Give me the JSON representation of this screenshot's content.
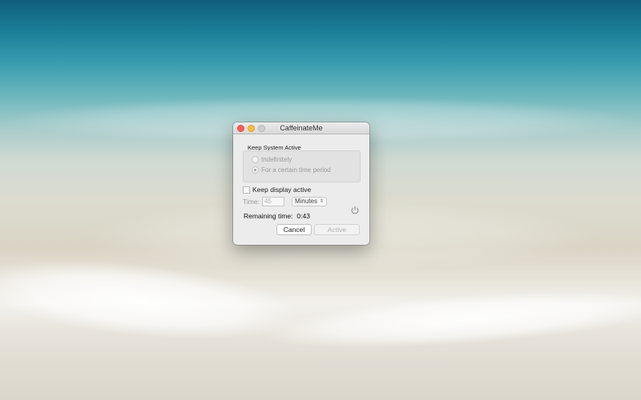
{
  "window": {
    "title": "CaffeinateMe"
  },
  "keep_system_active": {
    "label": "Keep System Active",
    "options": [
      {
        "label": "Indefinitely",
        "selected": false
      },
      {
        "label": "For a certain time period",
        "selected": true
      }
    ]
  },
  "keep_display": {
    "label": "Keep display active",
    "checked": false
  },
  "time": {
    "label": "Time:",
    "placeholder": "45",
    "unit_selected": "Minutes"
  },
  "remaining": {
    "label": "Remaining time:",
    "value": "0:43"
  },
  "buttons": {
    "cancel": "Cancel",
    "active": "Active"
  },
  "icons": {
    "power": "power-icon",
    "close": "close-icon",
    "minimize": "minimize-icon",
    "zoom": "zoom-icon"
  }
}
